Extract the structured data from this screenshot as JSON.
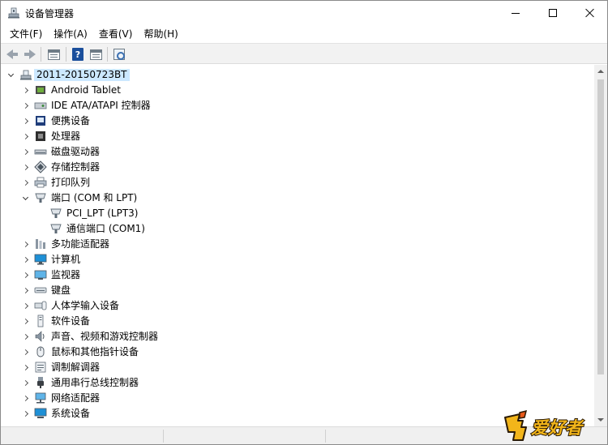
{
  "window": {
    "title": "设备管理器"
  },
  "menu": [
    {
      "label": "文件(F)"
    },
    {
      "label": "操作(A)"
    },
    {
      "label": "查看(V)"
    },
    {
      "label": "帮助(H)"
    }
  ],
  "tree": {
    "root": "2011-20150723BT",
    "categories": [
      {
        "label": "Android Tablet",
        "icon": "tablet-icon"
      },
      {
        "label": "IDE ATA/ATAPI 控制器",
        "icon": "ide-controller-icon"
      },
      {
        "label": "便携设备",
        "icon": "portable-device-icon"
      },
      {
        "label": "处理器",
        "icon": "processor-icon"
      },
      {
        "label": "磁盘驱动器",
        "icon": "disk-drive-icon"
      },
      {
        "label": "存储控制器",
        "icon": "storage-controller-icon"
      },
      {
        "label": "打印队列",
        "icon": "printer-icon"
      },
      {
        "label": "端口 (COM 和 LPT)",
        "icon": "port-icon",
        "expanded": true,
        "children": [
          {
            "label": "PCI_LPT (LPT3)",
            "icon": "port-icon"
          },
          {
            "label": "通信端口 (COM1)",
            "icon": "port-icon"
          }
        ]
      },
      {
        "label": "多功能适配器",
        "icon": "multifunction-adapter-icon"
      },
      {
        "label": "计算机",
        "icon": "computer-icon"
      },
      {
        "label": "监视器",
        "icon": "monitor-icon"
      },
      {
        "label": "键盘",
        "icon": "keyboard-icon"
      },
      {
        "label": "人体学输入设备",
        "icon": "hid-icon"
      },
      {
        "label": "软件设备",
        "icon": "software-device-icon"
      },
      {
        "label": "声音、视频和游戏控制器",
        "icon": "audio-icon"
      },
      {
        "label": "鼠标和其他指针设备",
        "icon": "mouse-icon"
      },
      {
        "label": "调制解调器",
        "icon": "modem-icon"
      },
      {
        "label": "通用串行总线控制器",
        "icon": "usb-icon"
      },
      {
        "label": "网络适配器",
        "icon": "network-adapter-icon"
      },
      {
        "label": "系统设备",
        "icon": "system-device-icon"
      }
    ]
  },
  "watermark": {
    "text": "爱好者",
    "logo": "木虫"
  },
  "colors": {
    "selection": "#cce8ff",
    "toolbar_bg": "#f2f2f2",
    "watermark_orange": "#e8a317"
  }
}
